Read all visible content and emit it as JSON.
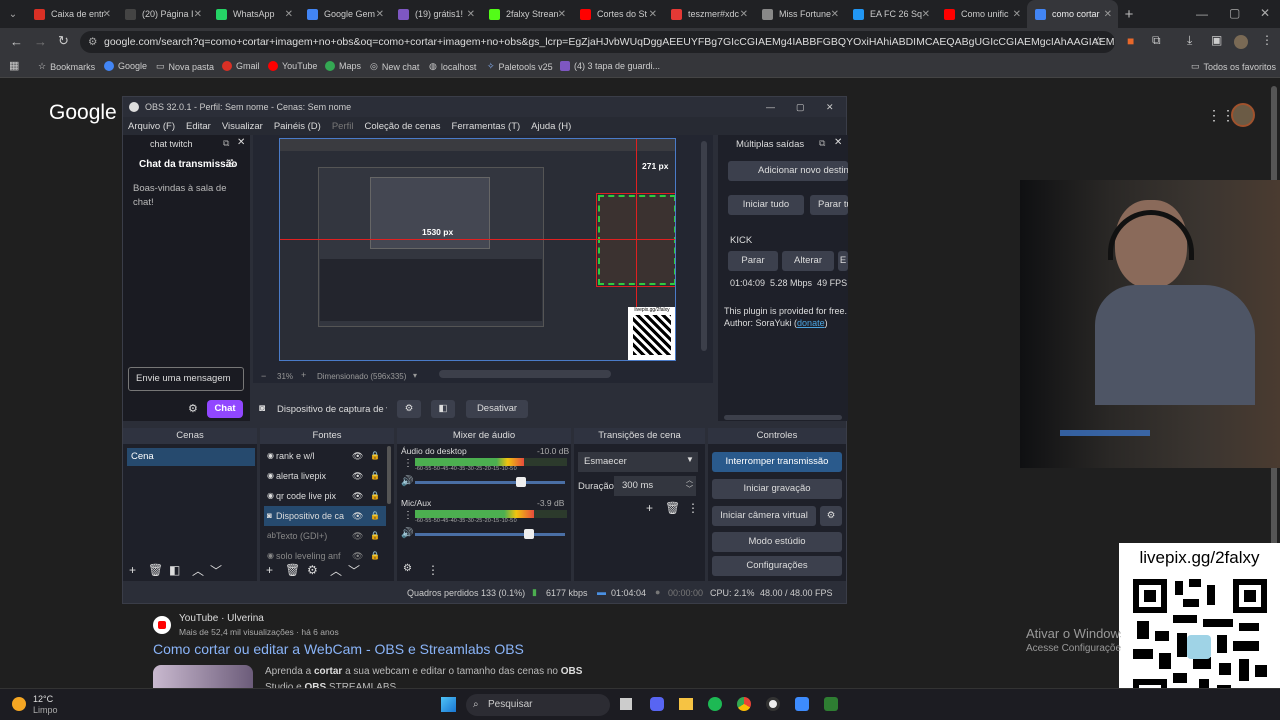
{
  "browser": {
    "tabs": [
      {
        "label": "Caixa de entr",
        "color": "#d93025"
      },
      {
        "label": "(20) Página I",
        "color": "#444"
      },
      {
        "label": "WhatsApp",
        "color": "#25d366"
      },
      {
        "label": "Google Gem",
        "color": "#4285f4"
      },
      {
        "label": "(19) grátis1!",
        "color": "#7e57c2"
      },
      {
        "label": "2falxy Strean",
        "color": "#53fc18"
      },
      {
        "label": "Cortes do St",
        "color": "#ff0000"
      },
      {
        "label": "teszmer#xdc",
        "color": "#e53935"
      },
      {
        "label": "Miss Fortune",
        "color": "#888"
      },
      {
        "label": "EA FC 26 Sq",
        "color": "#2196f3"
      },
      {
        "label": "Como unific",
        "color": "#ff0000"
      },
      {
        "label": "como cortar",
        "color": "#4285f4"
      }
    ],
    "url": "google.com/search?q=como+cortar+imagem+no+obs&oq=como+cortar+imagem+no+obs&gs_lcrp=EgZjaHJvbWUqDggAEEUYFBg7GIcCGIAEMg4IABBFGBQYOxiHAhiABDIMCAEQABgUGIcCGIAEMgcIAhAAGIAEMggIAxAAGBYYHjIICAQ...",
    "bookmarks": [
      "Bookmarks",
      "Google",
      "Nova pasta",
      "Gmail",
      "YouTube",
      "Maps",
      "New chat",
      "localhost",
      "Paletools v25",
      "(4) 3 tapa de guardi..."
    ],
    "all_bookmarks": "Todos os favoritos"
  },
  "google": {
    "logo": "Google"
  },
  "obs": {
    "title": "OBS 32.0.1 - Perfil: Sem nome - Cenas: Sem nome",
    "menu": [
      "Arquivo (F)",
      "Editar",
      "Visualizar",
      "Painéis (D)",
      "Perfil",
      "Coleção de cenas",
      "Ferramentas (T)",
      "Ajuda (H)"
    ],
    "chat": {
      "dock_title": "chat twitch",
      "header": "Chat da transmissão",
      "welcome": "Boas-vindas à sala de chat!",
      "placeholder": "Envie uma mensagem",
      "send": "Chat"
    },
    "preview": {
      "zoom": "31%",
      "size": "Dimensionado (596x335)",
      "measure_top": "271 px",
      "measure_mid": "1530 px",
      "qr": "livepix.gg/2falxy"
    },
    "multi": {
      "title": "Múltiplas saídas",
      "add": "Adicionar novo destino",
      "start_all": "Iniciar tudo",
      "stop_all": "Parar tudo",
      "kick": "KICK",
      "stop": "Parar",
      "change": "Alterar",
      "edit": "E",
      "stats": "01:04:09  5.28 Mbps  49 FPS",
      "plugin": "This plugin is provided for free.",
      "author_prefix": "Author: SoraYuki (",
      "donate": "donate",
      "author_suffix": ")"
    },
    "source_bar": {
      "name": "Dispositivo de captura de v",
      "deactivate": "Desativar"
    },
    "docks": {
      "scenes": "Cenas",
      "sources": "Fontes",
      "mixer": "Mixer de áudio",
      "transitions": "Transições de cena",
      "controls": "Controles"
    },
    "scenes": [
      "Cena"
    ],
    "sources": [
      "rank e w/l",
      "alerta livepix",
      "qr code live pix",
      "Dispositivo de ca",
      "Texto (GDI+)",
      "solo leveling anf"
    ],
    "mixer": [
      {
        "name": "Áudio do desktop",
        "db": "-10.0 dB",
        "level": 0.72
      },
      {
        "name": "Mic/Aux",
        "db": "-3.9 dB",
        "level": 0.78
      }
    ],
    "meter_scale": "-60 -55 -50 -45 -40 -35 -30 -25 -20 -15 -10 -5 0",
    "transition": {
      "type": "Esmaecer",
      "duration_label": "Duração",
      "duration": "300 ms"
    },
    "controls": [
      "Interromper transmissão",
      "Iniciar gravação",
      "Iniciar câmera virtual",
      "Modo estúdio",
      "Configurações"
    ],
    "status": {
      "dropped": "Quadros perdidos 133 (0.1%)",
      "kbps": "6177 kbps",
      "stream_time": "01:04:04",
      "rec_time": "00:00:00",
      "cpu": "CPU: 2.1%",
      "fps": "48.00 / 48.00 FPS"
    }
  },
  "result": {
    "channel": "YouTube · Ulverina",
    "meta": "Mais de 52,4 mil visualizações · há 6 anos",
    "title": "Como cortar ou editar a WebCam - OBS e Streamlabs OBS",
    "snippet_1": "Aprenda a ",
    "snippet_b1": "cortar",
    "snippet_2": " a sua webcam e editar o tamanho das cenas no ",
    "snippet_b2": "OBS",
    "snippet_3": "Studio e ",
    "snippet_b3": "OBS",
    "snippet_4": " STREAMLABS ..."
  },
  "overlay": {
    "qr_label": "livepix.gg/2falxy",
    "activate": "Ativar o Windows",
    "activate_sub": "Acesse Configurações"
  },
  "taskbar": {
    "temp": "12°C",
    "weather": "Limpo",
    "search": "Pesquisar"
  }
}
